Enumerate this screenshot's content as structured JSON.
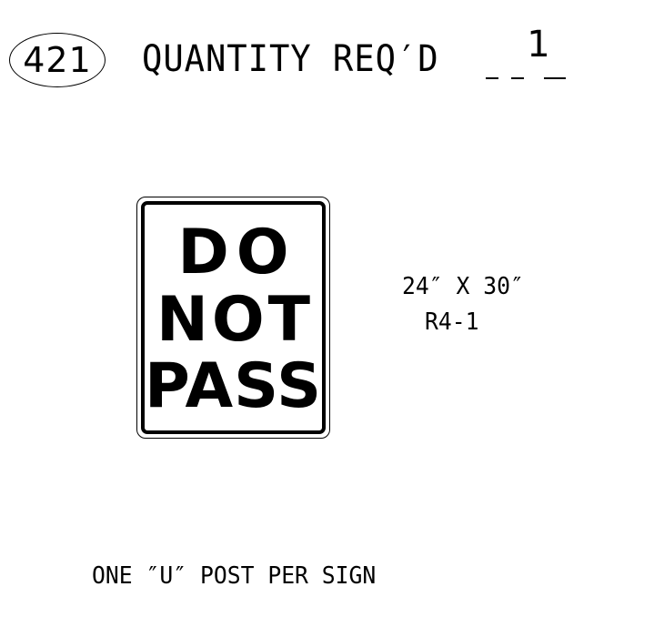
{
  "item": {
    "number": "421"
  },
  "quantity": {
    "label": "QUANTITY REQ′D",
    "value": "1"
  },
  "sign": {
    "lines": [
      "DO",
      "NOT",
      "PASS"
    ],
    "size": "24″ X 30″",
    "code": "R4-1"
  },
  "note": "ONE ″U″ POST PER SIGN",
  "colors": {
    "ink": "#000000",
    "background": "#ffffff"
  }
}
